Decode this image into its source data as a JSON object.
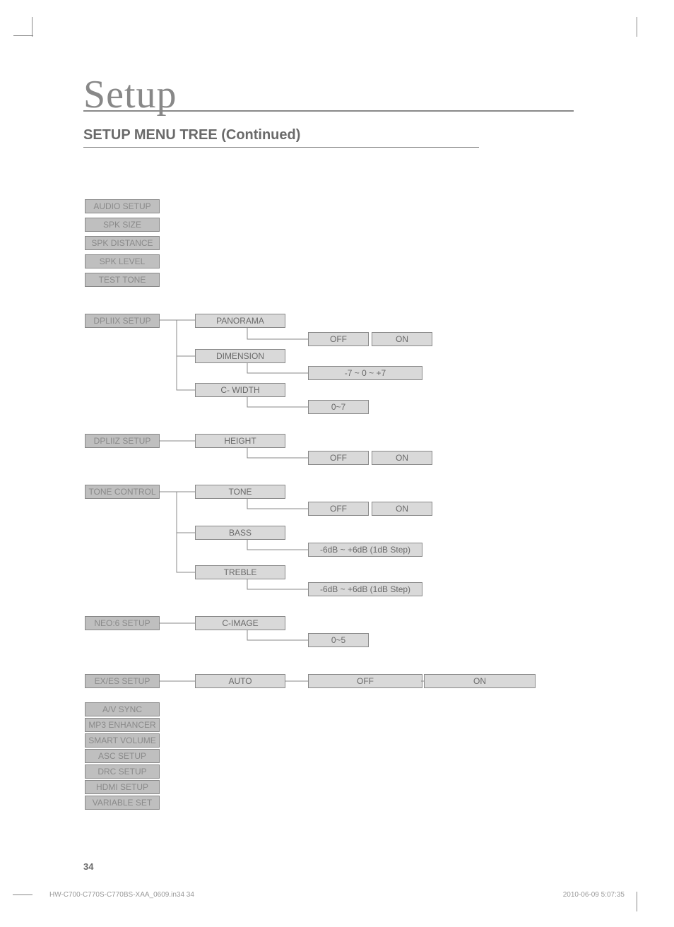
{
  "page": {
    "title": "Setup",
    "section_title": "SETUP MENU TREE (Continued)",
    "number": "34",
    "footer_left": "HW-C700-C770S-C770BS-XAA_0609.in34   34",
    "footer_right": "2010-06-09   5:07:35"
  },
  "top_menu": {
    "items": [
      "AUDIO SETUP",
      "SPK SIZE",
      "SPK DISTANCE",
      "SPK LEVEL",
      "TEST TONE"
    ]
  },
  "dpliix": {
    "label": "DPLIIX SETUP",
    "panorama": {
      "label": "PANORAMA",
      "off": "OFF",
      "on": "ON"
    },
    "dimension": {
      "label": "DIMENSION",
      "range": "-7 ~ 0 ~ +7"
    },
    "cwidth": {
      "label": "C- WIDTH",
      "range": "0~7"
    }
  },
  "dpliiz": {
    "label": "DPLIIZ SETUP",
    "height": {
      "label": "HEIGHT",
      "off": "OFF",
      "on": "ON"
    }
  },
  "tone": {
    "label": "TONE CONTROL",
    "tone": {
      "label": "TONE",
      "off": "OFF",
      "on": "ON"
    },
    "bass": {
      "label": "BASS",
      "range": "-6dB ~ +6dB (1dB Step)"
    },
    "treble": {
      "label": "TREBLE",
      "range": "-6dB ~ +6dB (1dB Step)"
    }
  },
  "neo6": {
    "label": "NEO:6 SETUP",
    "cimage": {
      "label": "C-IMAGE",
      "range": "0~5"
    }
  },
  "exes": {
    "label": "EX/ES SETUP",
    "auto": "AUTO",
    "off": "OFF",
    "on": "ON"
  },
  "bottom_menu": {
    "items": [
      "A/V SYNC",
      "MP3 ENHANCER",
      "SMART VOLUME",
      "ASC SETUP",
      "DRC SETUP",
      "HDMI SETUP",
      "VARIABLE SET"
    ]
  }
}
